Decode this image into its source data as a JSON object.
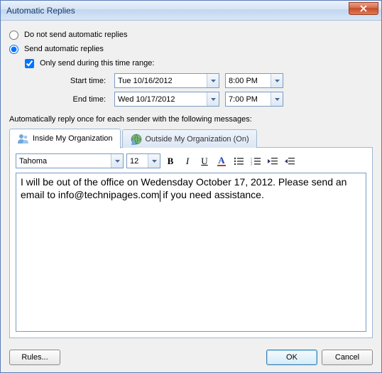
{
  "window": {
    "title": "Automatic Replies"
  },
  "radios": {
    "do_not_send": "Do not send automatic replies",
    "send": "Send automatic replies"
  },
  "time_range": {
    "checkbox_label": "Only send during this time range:",
    "start_label": "Start time:",
    "end_label": "End time:",
    "start_date": "Tue 10/16/2012",
    "start_time": "8:00 PM",
    "end_date": "Wed 10/17/2012",
    "end_time": "7:00 PM"
  },
  "section_label": "Automatically reply once for each sender with the following messages:",
  "tabs": {
    "inside": "Inside My Organization",
    "outside": "Outside My Organization (On)"
  },
  "format": {
    "font_name": "Tahoma",
    "font_size": "12"
  },
  "message": {
    "part1": "I will be out of the office on Wedensday October 17, 2012. Please send an email to info@technipages.com",
    "part2": " if you need assistance."
  },
  "buttons": {
    "rules": "Rules...",
    "ok": "OK",
    "cancel": "Cancel"
  }
}
